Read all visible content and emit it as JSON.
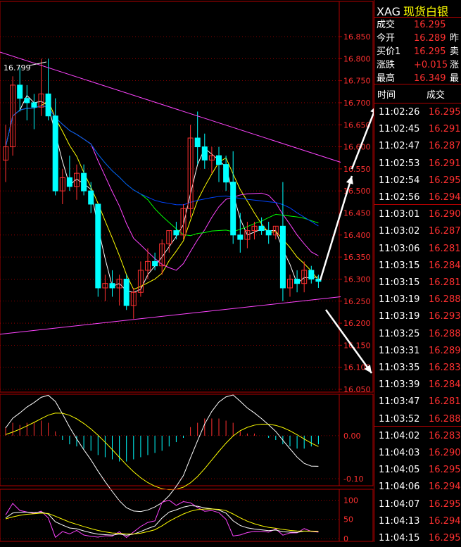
{
  "colors": {
    "up": "#ff3030",
    "down": "#00ffff",
    "grid": "#b00000",
    "axis_text": "#ff3030",
    "triangle": "#ff44ff",
    "arrow": "#ffffff"
  },
  "quote": {
    "code": "XAG",
    "name": "现货白银",
    "rows": [
      {
        "label": "成交",
        "value": "16.295",
        "extra": ""
      },
      {
        "label": "今开",
        "value": "16.289",
        "extra": "昨"
      },
      {
        "label": "买价1",
        "value": "16.295",
        "extra": "卖"
      },
      {
        "label": "涨跌",
        "value": "+0.015",
        "extra": "涨"
      },
      {
        "label": "最高",
        "value": "16.349",
        "extra": "最"
      }
    ]
  },
  "ticks": {
    "headers": {
      "time": "时间",
      "price": "成交"
    },
    "rows": [
      {
        "time": "11:02:26",
        "price": "16.295"
      },
      {
        "time": "11:02:45",
        "price": "16.291"
      },
      {
        "time": "11:02:47",
        "price": "16.287"
      },
      {
        "time": "11:02:53",
        "price": "16.291"
      },
      {
        "time": "11:02:54",
        "price": "16.295"
      },
      {
        "time": "11:02:56",
        "price": "16.294"
      },
      {
        "time": "11:03:01",
        "price": "16.290"
      },
      {
        "time": "11:03:02",
        "price": "16.287"
      },
      {
        "time": "11:03:06",
        "price": "16.281"
      },
      {
        "time": "11:03:15",
        "price": "16.284"
      },
      {
        "time": "11:03:15",
        "price": "16.281"
      },
      {
        "time": "11:03:19",
        "price": "16.288"
      },
      {
        "time": "11:03:19",
        "price": "16.293"
      },
      {
        "time": "11:03:25",
        "price": "16.288"
      },
      {
        "time": "11:03:31",
        "price": "16.289"
      },
      {
        "time": "11:03:35",
        "price": "16.283"
      },
      {
        "time": "11:03:39",
        "price": "16.284"
      },
      {
        "time": "11:03:47",
        "price": "16.281"
      },
      {
        "time": "11:03:52",
        "price": "16.288"
      },
      {
        "time": "11:04:02",
        "price": "16.283"
      },
      {
        "time": "11:04:03",
        "price": "16.290"
      },
      {
        "time": "11:04:05",
        "price": "16.295"
      },
      {
        "time": "11:04:06",
        "price": "16.294"
      },
      {
        "time": "11:04:07",
        "price": "16.295"
      },
      {
        "time": "11:04:13",
        "price": "16.294"
      },
      {
        "time": "11:04:15",
        "price": "16.295"
      }
    ]
  },
  "chart_data": {
    "type": "candlestick",
    "price_ticks": [
      "16.850",
      "16.800",
      "16.750",
      "16.700",
      "16.650",
      "16.600",
      "16.550",
      "16.500",
      "16.450",
      "16.400",
      "16.350",
      "16.300",
      "16.250",
      "16.200",
      "16.150",
      "16.100",
      "16.050"
    ],
    "ylim": [
      16.05,
      16.85
    ],
    "high_annotation": "16.799",
    "candles": [
      {
        "o": 16.57,
        "h": 16.65,
        "l": 16.52,
        "c": 16.6
      },
      {
        "o": 16.6,
        "h": 16.76,
        "l": 16.58,
        "c": 16.74
      },
      {
        "o": 16.74,
        "h": 16.78,
        "l": 16.68,
        "c": 16.71
      },
      {
        "o": 16.71,
        "h": 16.74,
        "l": 16.66,
        "c": 16.7
      },
      {
        "o": 16.7,
        "h": 16.72,
        "l": 16.64,
        "c": 16.69
      },
      {
        "o": 16.69,
        "h": 16.8,
        "l": 16.67,
        "c": 16.72
      },
      {
        "o": 16.72,
        "h": 16.8,
        "l": 16.66,
        "c": 16.67
      },
      {
        "o": 16.67,
        "h": 16.71,
        "l": 16.49,
        "c": 16.5
      },
      {
        "o": 16.5,
        "h": 16.55,
        "l": 16.47,
        "c": 16.53
      },
      {
        "o": 16.53,
        "h": 16.58,
        "l": 16.5,
        "c": 16.51
      },
      {
        "o": 16.51,
        "h": 16.56,
        "l": 16.48,
        "c": 16.54
      },
      {
        "o": 16.54,
        "h": 16.56,
        "l": 16.49,
        "c": 16.5
      },
      {
        "o": 16.5,
        "h": 16.52,
        "l": 16.45,
        "c": 16.47
      },
      {
        "o": 16.47,
        "h": 16.47,
        "l": 16.26,
        "c": 16.28
      },
      {
        "o": 16.28,
        "h": 16.31,
        "l": 16.25,
        "c": 16.29
      },
      {
        "o": 16.29,
        "h": 16.32,
        "l": 16.26,
        "c": 16.28
      },
      {
        "o": 16.28,
        "h": 16.31,
        "l": 16.24,
        "c": 16.3
      },
      {
        "o": 16.3,
        "h": 16.31,
        "l": 16.23,
        "c": 16.24
      },
      {
        "o": 16.24,
        "h": 16.28,
        "l": 16.21,
        "c": 16.27
      },
      {
        "o": 16.27,
        "h": 16.34,
        "l": 16.26,
        "c": 16.32
      },
      {
        "o": 16.32,
        "h": 16.37,
        "l": 16.3,
        "c": 16.34
      },
      {
        "o": 16.34,
        "h": 16.36,
        "l": 16.32,
        "c": 16.33
      },
      {
        "o": 16.33,
        "h": 16.39,
        "l": 16.31,
        "c": 16.38
      },
      {
        "o": 16.38,
        "h": 16.41,
        "l": 16.36,
        "c": 16.41
      },
      {
        "o": 16.41,
        "h": 16.43,
        "l": 16.39,
        "c": 16.4
      },
      {
        "o": 16.4,
        "h": 16.47,
        "l": 16.39,
        "c": 16.46
      },
      {
        "o": 16.46,
        "h": 16.65,
        "l": 16.44,
        "c": 16.62
      },
      {
        "o": 16.62,
        "h": 16.68,
        "l": 16.56,
        "c": 16.6
      },
      {
        "o": 16.6,
        "h": 16.63,
        "l": 16.55,
        "c": 16.57
      },
      {
        "o": 16.57,
        "h": 16.6,
        "l": 16.54,
        "c": 16.58
      },
      {
        "o": 16.58,
        "h": 16.6,
        "l": 16.52,
        "c": 16.56
      },
      {
        "o": 16.56,
        "h": 16.58,
        "l": 16.5,
        "c": 16.52
      },
      {
        "o": 16.52,
        "h": 16.59,
        "l": 16.38,
        "c": 16.4
      },
      {
        "o": 16.4,
        "h": 16.45,
        "l": 16.36,
        "c": 16.39
      },
      {
        "o": 16.39,
        "h": 16.43,
        "l": 16.37,
        "c": 16.41
      },
      {
        "o": 16.41,
        "h": 16.43,
        "l": 16.39,
        "c": 16.42
      },
      {
        "o": 16.42,
        "h": 16.44,
        "l": 16.4,
        "c": 16.41
      },
      {
        "o": 16.41,
        "h": 16.43,
        "l": 16.38,
        "c": 16.4
      },
      {
        "o": 16.4,
        "h": 16.42,
        "l": 16.39,
        "c": 16.42
      },
      {
        "o": 16.42,
        "h": 16.52,
        "l": 16.25,
        "c": 16.28
      },
      {
        "o": 16.28,
        "h": 16.31,
        "l": 16.26,
        "c": 16.3
      },
      {
        "o": 16.3,
        "h": 16.32,
        "l": 16.27,
        "c": 16.29
      },
      {
        "o": 16.29,
        "h": 16.34,
        "l": 16.27,
        "c": 16.32
      },
      {
        "o": 16.32,
        "h": 16.33,
        "l": 16.29,
        "c": 16.3
      },
      {
        "o": 16.3,
        "h": 16.31,
        "l": 16.28,
        "c": 16.295
      }
    ],
    "macd_ticks": [
      "0.00",
      "-0.10"
    ],
    "macd_ylim": [
      -0.1,
      0.08
    ],
    "macd_hist": [
      0.02,
      0.03,
      0.025,
      0.03,
      0.03,
      0.035,
      0.03,
      0.01,
      -0.01,
      -0.02,
      -0.025,
      -0.03,
      -0.035,
      -0.045,
      -0.05,
      -0.055,
      -0.06,
      -0.06,
      -0.055,
      -0.05,
      -0.045,
      -0.04,
      -0.035,
      -0.025,
      -0.015,
      -0.005,
      0.02,
      0.03,
      0.04,
      0.04,
      0.04,
      0.035,
      0.03,
      0.01,
      0.005,
      0.005,
      0.0,
      -0.005,
      -0.01,
      -0.02,
      -0.025,
      -0.03,
      -0.03,
      -0.025,
      -0.02
    ],
    "kdj_ticks": [
      "100",
      "50",
      "0"
    ],
    "kdj_ylim": [
      0,
      110
    ]
  }
}
